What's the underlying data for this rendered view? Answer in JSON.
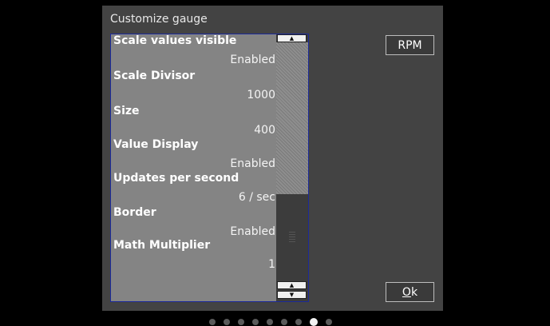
{
  "dialog": {
    "title": "Customize gauge"
  },
  "settings": [
    {
      "label": "Scale values visible",
      "value": "Enabled"
    },
    {
      "label": "Scale Divisor",
      "value": "1000"
    },
    {
      "label": "Size",
      "value": "400"
    },
    {
      "label": "Value Display",
      "value": "Enabled"
    },
    {
      "label": "Updates per second",
      "value": "6 / sec"
    },
    {
      "label": "Border",
      "value": "Enabled"
    },
    {
      "label": "Math Multiplier",
      "value": "1"
    }
  ],
  "buttons": {
    "rpm_label": "RPM",
    "ok_label": "Ok"
  },
  "scrollbar": {
    "up_glyph": "▲",
    "down_glyph": "▼"
  },
  "page_indicator": {
    "count": 9,
    "active_index": 7
  },
  "colors": {
    "dialog_background": "#434343",
    "list_background": "#848484",
    "list_border": "#1c2a9a",
    "screen_background": "#000000"
  }
}
